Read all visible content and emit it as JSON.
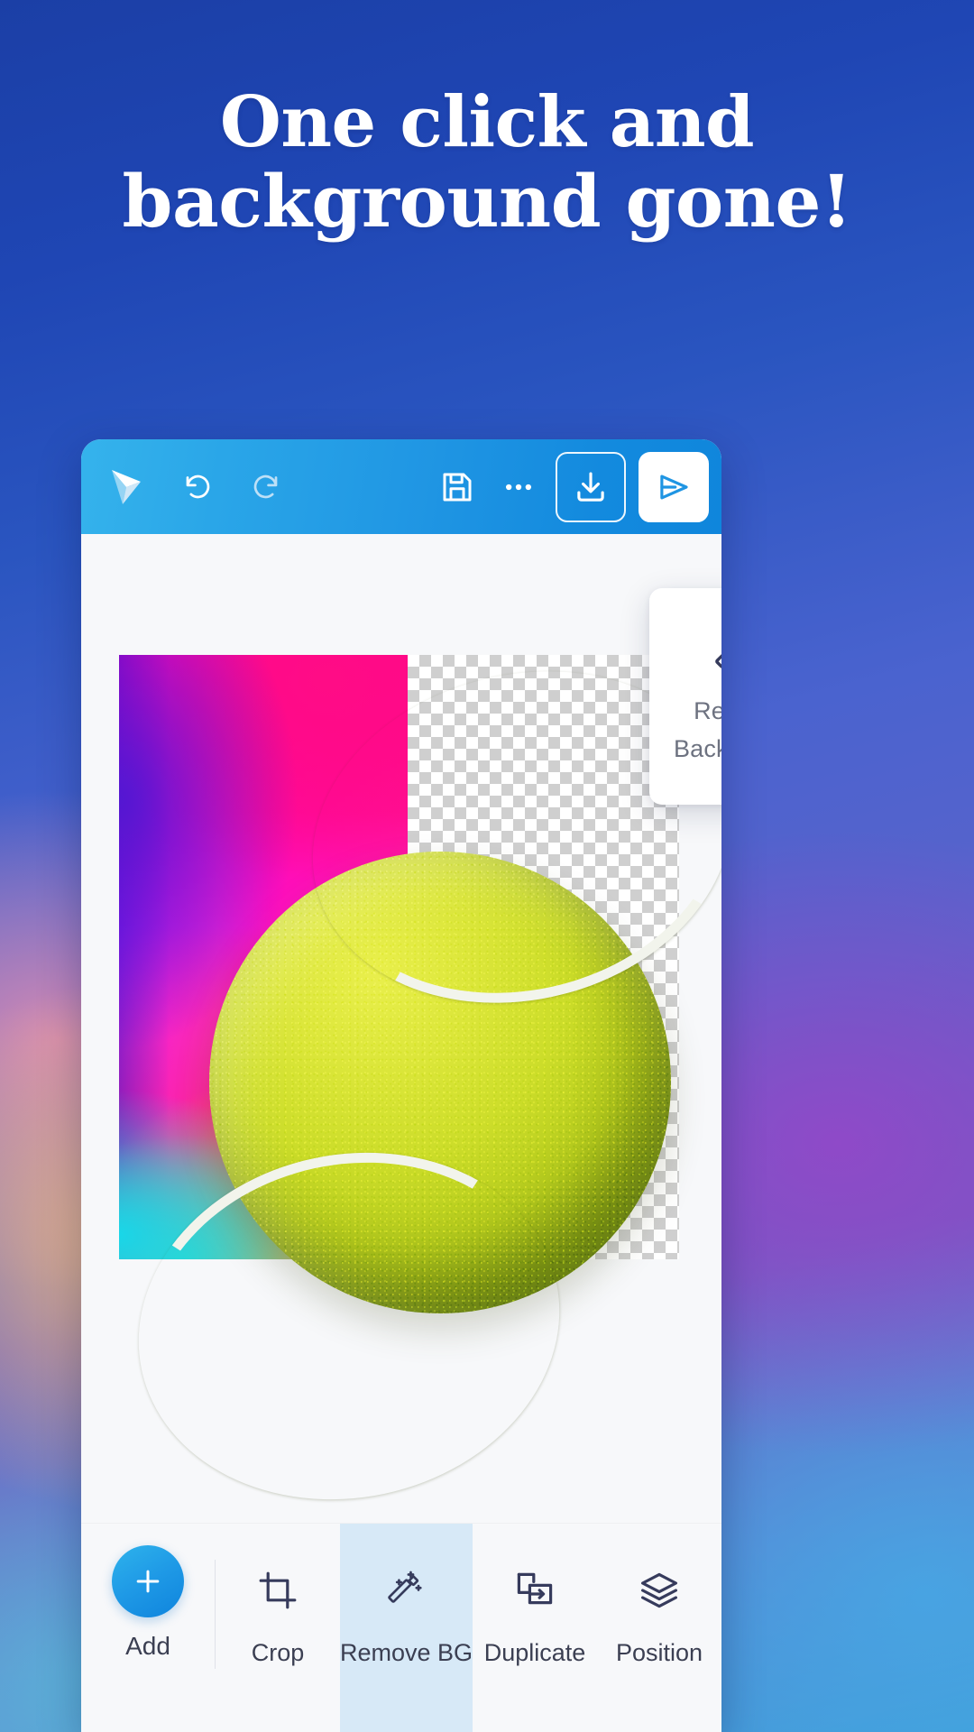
{
  "headline": {
    "line1": "One click and",
    "line2": "background gone!"
  },
  "colors": {
    "toolbar_blue": "#1f95e3",
    "accent_blue": "#1f9ae6",
    "active_tool_bg": "#d7e9f7",
    "icon_dark": "#363b5c",
    "label_gray": "#6d7280"
  },
  "app": {
    "toolbar": {
      "logo": "paper-plane-logo",
      "undo": {
        "icon": "undo-icon",
        "label": "Undo"
      },
      "redo": {
        "icon": "redo-icon",
        "label": "Redo"
      },
      "save": {
        "icon": "floppy-disk-save-icon",
        "label": "Save"
      },
      "more": {
        "icon": "more-horizontal-icon",
        "label": "More"
      },
      "download": {
        "icon": "download-icon",
        "label": "Download"
      },
      "share": {
        "icon": "send-share-icon",
        "label": "Share"
      }
    },
    "tooltip_card": {
      "icon": "magic-wand-icon",
      "line1": "Remove",
      "line2": "Background"
    },
    "bottom_bar": {
      "add": {
        "icon": "plus-icon",
        "label": "Add"
      },
      "tools": [
        {
          "icon": "crop-icon",
          "label": "Crop",
          "active": false
        },
        {
          "icon": "magic-wand-icon",
          "label": "Remove BG",
          "active": true
        },
        {
          "icon": "duplicate-icon",
          "label": "Duplicate",
          "active": false
        },
        {
          "icon": "layers-icon",
          "label": "Position",
          "active": false
        }
      ]
    },
    "canvas": {
      "artboard_alt": "tennis-ball-on-gradient-background",
      "transparency_alt": "checkerboard-transparency"
    }
  }
}
